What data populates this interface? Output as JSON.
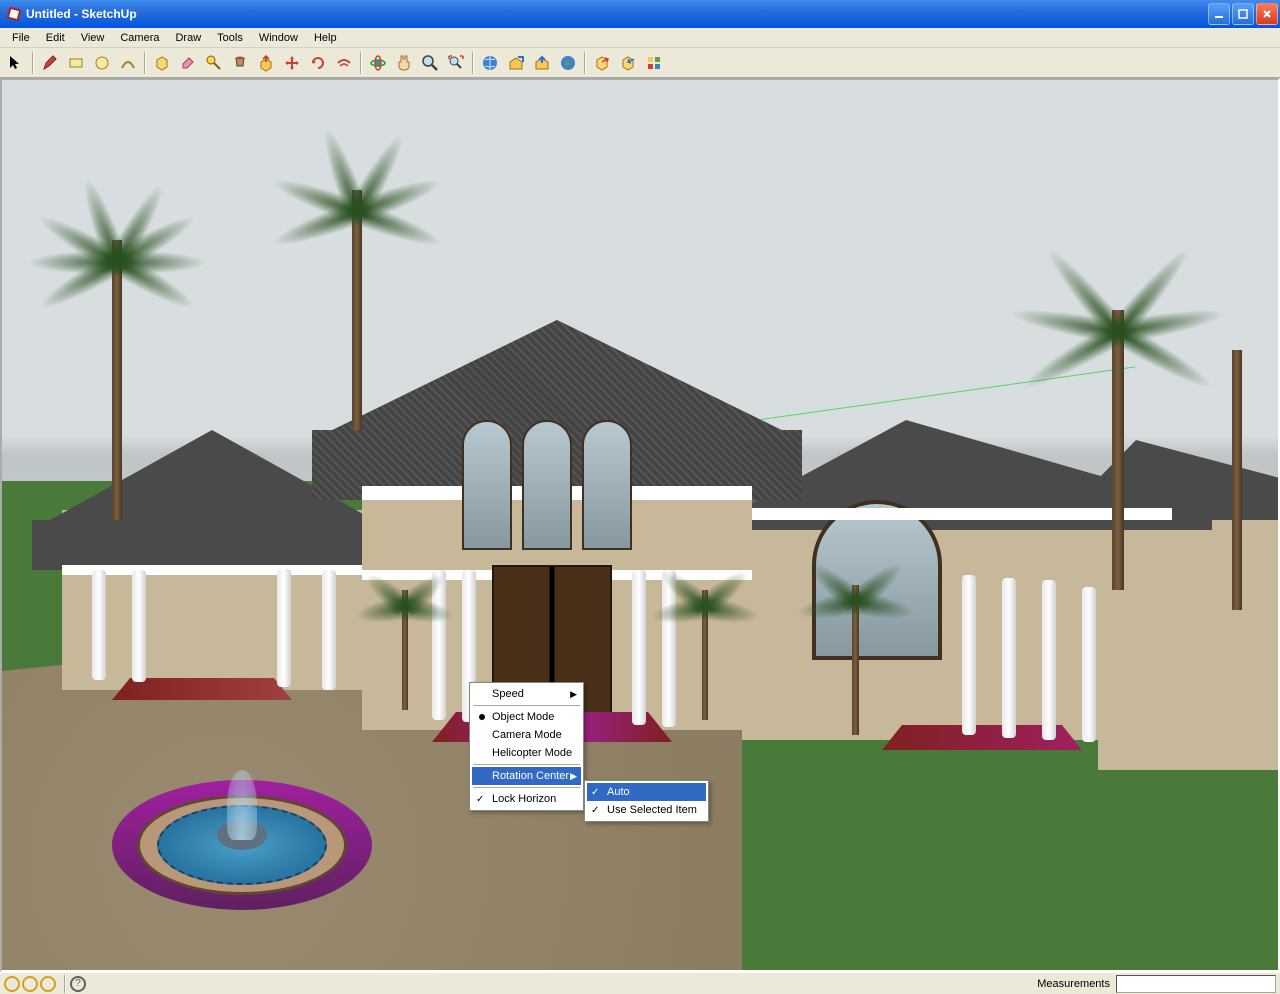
{
  "window": {
    "title": "Untitled - SketchUp"
  },
  "menubar": [
    "File",
    "Edit",
    "View",
    "Camera",
    "Draw",
    "Tools",
    "Window",
    "Help"
  ],
  "toolbar_icons": [
    "select",
    "pencil",
    "rectangle",
    "circle",
    "arc",
    "sep",
    "make-component",
    "eraser",
    "tape-measure",
    "paint-bucket",
    "push-pull",
    "move",
    "rotate",
    "offset",
    "sep",
    "orbit",
    "pan",
    "zoom",
    "zoom-extents",
    "sep",
    "get-models",
    "share-model",
    "upload",
    "layers",
    "sep",
    "preferences",
    "sign-in"
  ],
  "context_menu": {
    "items": [
      {
        "label": "Speed",
        "submenu": true
      },
      {
        "sep": true
      },
      {
        "label": "Object Mode",
        "radio": true,
        "selected": true
      },
      {
        "label": "Camera Mode"
      },
      {
        "label": "Helicopter Mode"
      },
      {
        "sep": true
      },
      {
        "label": "Rotation Center",
        "submenu": true,
        "highlighted": true
      },
      {
        "sep": true
      },
      {
        "label": "Lock Horizon",
        "checked": true
      }
    ]
  },
  "submenu": {
    "items": [
      {
        "label": "Auto",
        "checked": true,
        "highlighted": true
      },
      {
        "label": "Use Selected Item",
        "checked": true
      }
    ]
  },
  "statusbar": {
    "measurements_label": "Measurements"
  }
}
